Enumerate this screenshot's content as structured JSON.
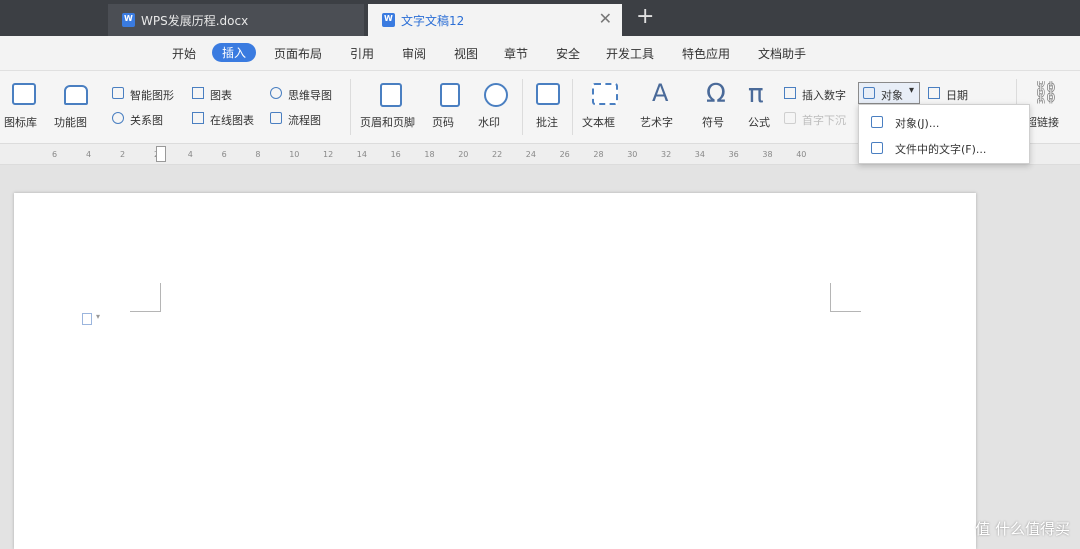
{
  "tabs": [
    {
      "label": "WPS发展历程.docx"
    },
    {
      "label": "文字文稿12"
    }
  ],
  "menu": [
    "开始",
    "插入",
    "页面布局",
    "引用",
    "审阅",
    "视图",
    "章节",
    "安全",
    "开发工具",
    "特色应用",
    "文档助手"
  ],
  "ribbon": {
    "icon_lib": "图标库",
    "func_chart": "功能图",
    "smart_shape": "智能图形",
    "chart": "图表",
    "mind_map": "思维导图",
    "relation": "关系图",
    "online_chart": "在线图表",
    "flowchart": "流程图",
    "header_footer": "页眉和页脚",
    "page_num": "页码",
    "watermark": "水印",
    "comment": "批注",
    "textbox": "文本框",
    "wordart": "艺术字",
    "symbol": "符号",
    "formula": "公式",
    "insert_number": "插入数字",
    "first_drop": "首字下沉",
    "object": "对象",
    "date": "日期",
    "hyperlink": "超链接"
  },
  "dropdown": {
    "items": [
      "对象(J)...",
      "文件中的文字(F)..."
    ]
  },
  "ruler_ticks": [
    "6",
    "4",
    "2",
    "2",
    "4",
    "6",
    "8",
    "10",
    "12",
    "14",
    "16",
    "18",
    "20",
    "22",
    "24",
    "26",
    "28",
    "30",
    "32",
    "34",
    "36",
    "38",
    "40"
  ],
  "watermark_text": "值 什么值得买",
  "colors": {
    "accent": "#3a7be0",
    "titlebar": "#3c3f44"
  }
}
